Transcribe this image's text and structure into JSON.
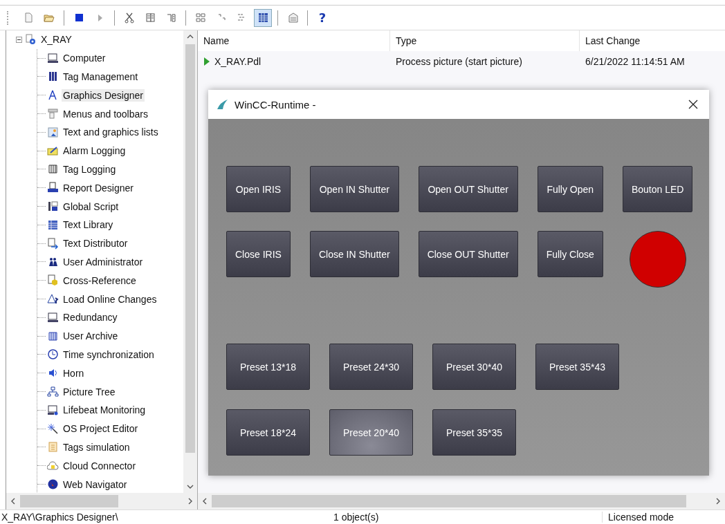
{
  "toolbar": {
    "buttons": [
      {
        "selected": false
      },
      {
        "selected": false
      },
      {
        "selected": false
      },
      {
        "selected": false
      },
      {
        "selected": false
      },
      {
        "selected": false
      },
      {
        "selected": false
      },
      {
        "selected": false
      },
      {
        "selected": false
      },
      {
        "selected": false
      },
      {
        "selected": true
      },
      {
        "selected": false
      }
    ],
    "help": "?"
  },
  "tree": {
    "root": {
      "label": "X_RAY",
      "expanded": true,
      "selected": false,
      "children": [
        {
          "label": "Computer",
          "selected": false
        },
        {
          "label": "Tag Management",
          "selected": false
        },
        {
          "label": "Graphics Designer",
          "selected": true
        },
        {
          "label": "Menus and toolbars",
          "selected": false
        },
        {
          "label": "Text and graphics lists",
          "selected": false
        },
        {
          "label": "Alarm Logging",
          "selected": false
        },
        {
          "label": "Tag Logging",
          "selected": false
        },
        {
          "label": "Report Designer",
          "selected": false
        },
        {
          "label": "Global Script",
          "selected": false
        },
        {
          "label": "Text Library",
          "selected": false
        },
        {
          "label": "Text Distributor",
          "selected": false
        },
        {
          "label": "User Administrator",
          "selected": false
        },
        {
          "label": "Cross-Reference",
          "selected": false
        },
        {
          "label": "Load Online Changes",
          "selected": false
        },
        {
          "label": "Redundancy",
          "selected": false
        },
        {
          "label": "User Archive",
          "selected": false
        },
        {
          "label": "Time synchronization",
          "selected": false
        },
        {
          "label": "Horn",
          "selected": false
        },
        {
          "label": "Picture Tree",
          "selected": false
        },
        {
          "label": "Lifebeat Monitoring",
          "selected": false
        },
        {
          "label": "OS Project Editor",
          "selected": false
        },
        {
          "label": "Tags simulation",
          "selected": false
        },
        {
          "label": "Cloud Connector",
          "selected": false
        },
        {
          "label": "Web Navigator",
          "selected": false
        }
      ]
    }
  },
  "file_list": {
    "columns": [
      "Name",
      "Type",
      "Last Change"
    ],
    "rows": [
      {
        "name": "X_RAY.Pdl",
        "type": "Process picture (start picture)",
        "last_change": "6/21/2022 11:14:51 AM"
      }
    ]
  },
  "runtime_window": {
    "title": "WinCC-Runtime -",
    "control_buttons": [
      "Open IRIS",
      "Open IN Shutter",
      "Open OUT Shutter",
      "Fully Open",
      "Bouton LED",
      "Close IRIS",
      "Close IN Shutter",
      "Close OUT Shutter",
      "Fully Close"
    ],
    "led": {
      "on": true
    },
    "presets": [
      {
        "label": "Preset 13*18",
        "highlighted": false
      },
      {
        "label": "Preset 24*30",
        "highlighted": false
      },
      {
        "label": "Preset 30*40",
        "highlighted": false
      },
      {
        "label": "Preset 35*43",
        "highlighted": false
      },
      {
        "label": "Preset 18*24",
        "highlighted": false
      },
      {
        "label": "Preset 20*40",
        "highlighted": true
      },
      {
        "label": "Preset 35*35",
        "highlighted": false
      }
    ]
  },
  "status_bar": [
    "X_RAY\\Graphics Designer\\",
    "1 object(s)",
    "Licensed mode"
  ]
}
